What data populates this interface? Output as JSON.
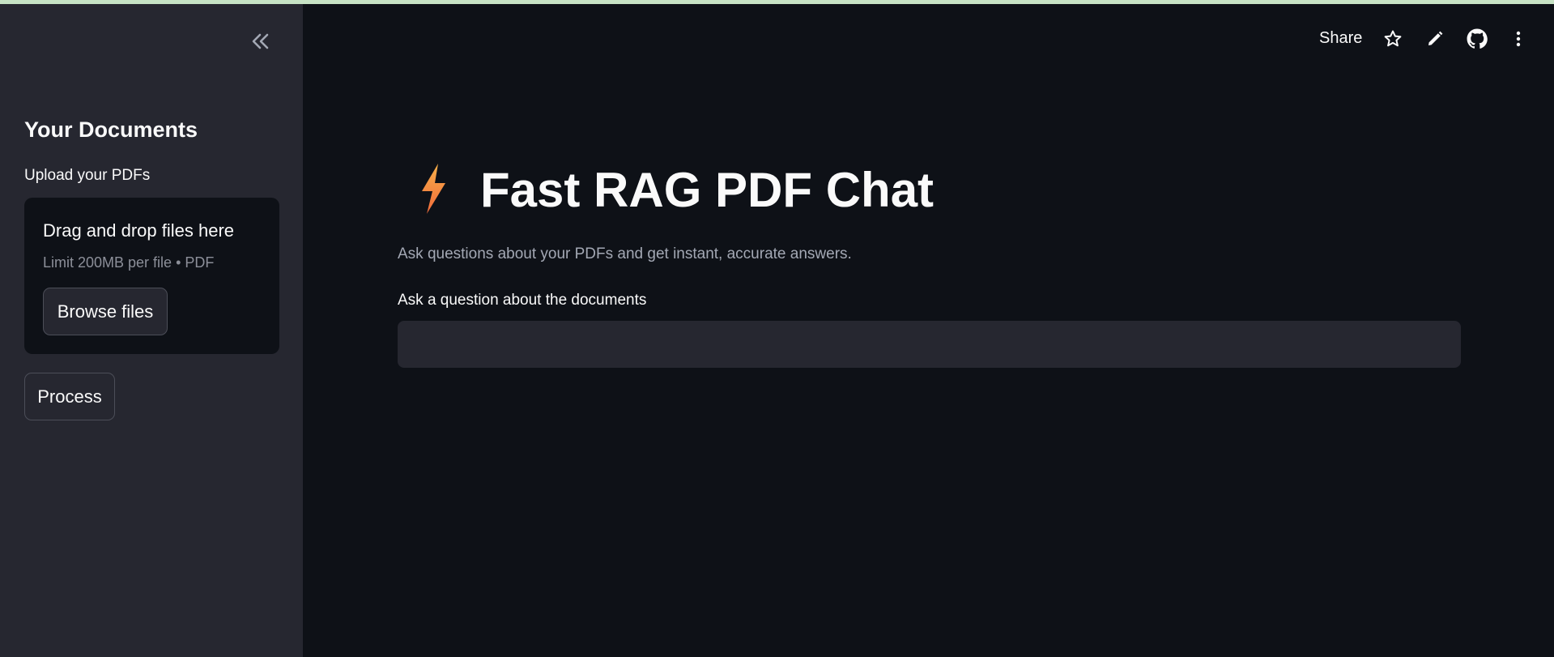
{
  "colors": {
    "top_stripe": "#c7e3c5",
    "sidebar_bg": "#262730",
    "main_bg": "#0e1117",
    "bolt_top": "#f8b04a",
    "bolt_bottom": "#f06a3a"
  },
  "sidebar": {
    "collapse_icon": "double-chevron-left-icon",
    "title": "Your Documents",
    "upload_label": "Upload your PDFs",
    "dropzone": {
      "title": "Drag and drop files here",
      "limit": "Limit 200MB per file • PDF",
      "browse_label": "Browse files"
    },
    "process_label": "Process"
  },
  "toolbar": {
    "share_label": "Share",
    "icons": [
      "star-icon",
      "pencil-icon",
      "github-icon",
      "kebab-menu-icon"
    ]
  },
  "main": {
    "title_icon": "lightning-bolt-icon",
    "title": "Fast RAG PDF Chat",
    "subtitle": "Ask questions about your PDFs and get instant, accurate answers.",
    "question_label": "Ask a question about the documents",
    "question_value": "",
    "question_placeholder": ""
  }
}
